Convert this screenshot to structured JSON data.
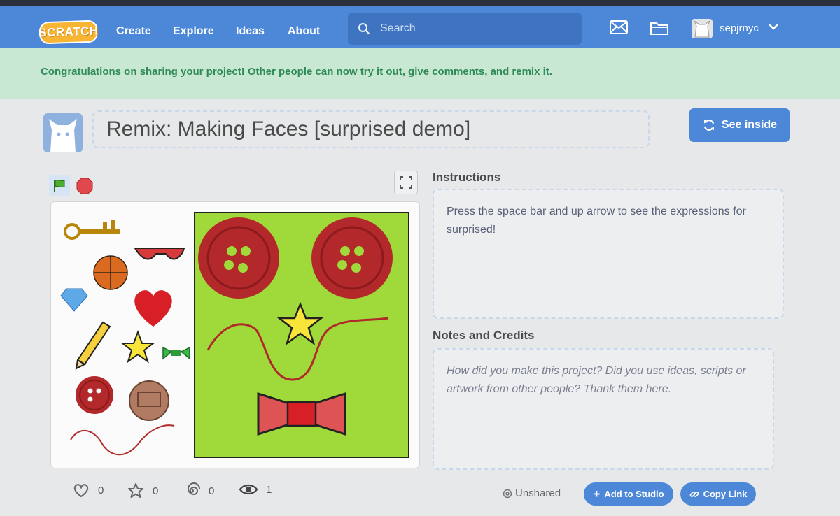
{
  "navbar": {
    "logo_text": "SCRATCH",
    "links": [
      "Create",
      "Explore",
      "Ideas",
      "About"
    ],
    "search_placeholder": "Search",
    "username": "sepjrnyc",
    "icons": [
      "messages-icon",
      "my-stuff-folder-icon",
      "chevron-down-icon"
    ],
    "bg_color": "#4d88d8"
  },
  "banner": {
    "text": "Congratulations on sharing your project! Other people can now try it out, give comments, and remix it.",
    "bg_color": "#c9e8d3"
  },
  "project": {
    "title": "Remix: Making Faces [surprised demo]",
    "see_inside_label": "See inside"
  },
  "instructions": {
    "heading": "Instructions",
    "text": "Press the space bar and up arrow to see the expressions for surprised!"
  },
  "notes": {
    "heading": "Notes and Credits",
    "text": "How did you make this project? Did you use ideas, scripts or artwork from other people? Thank them here."
  },
  "stats": {
    "loves": "0",
    "favorites": "0",
    "remixes": "0",
    "views": "1"
  },
  "share_status": "Unshared",
  "actions": {
    "add_to_studio": "Add to Studio",
    "copy_link": "Copy Link"
  }
}
